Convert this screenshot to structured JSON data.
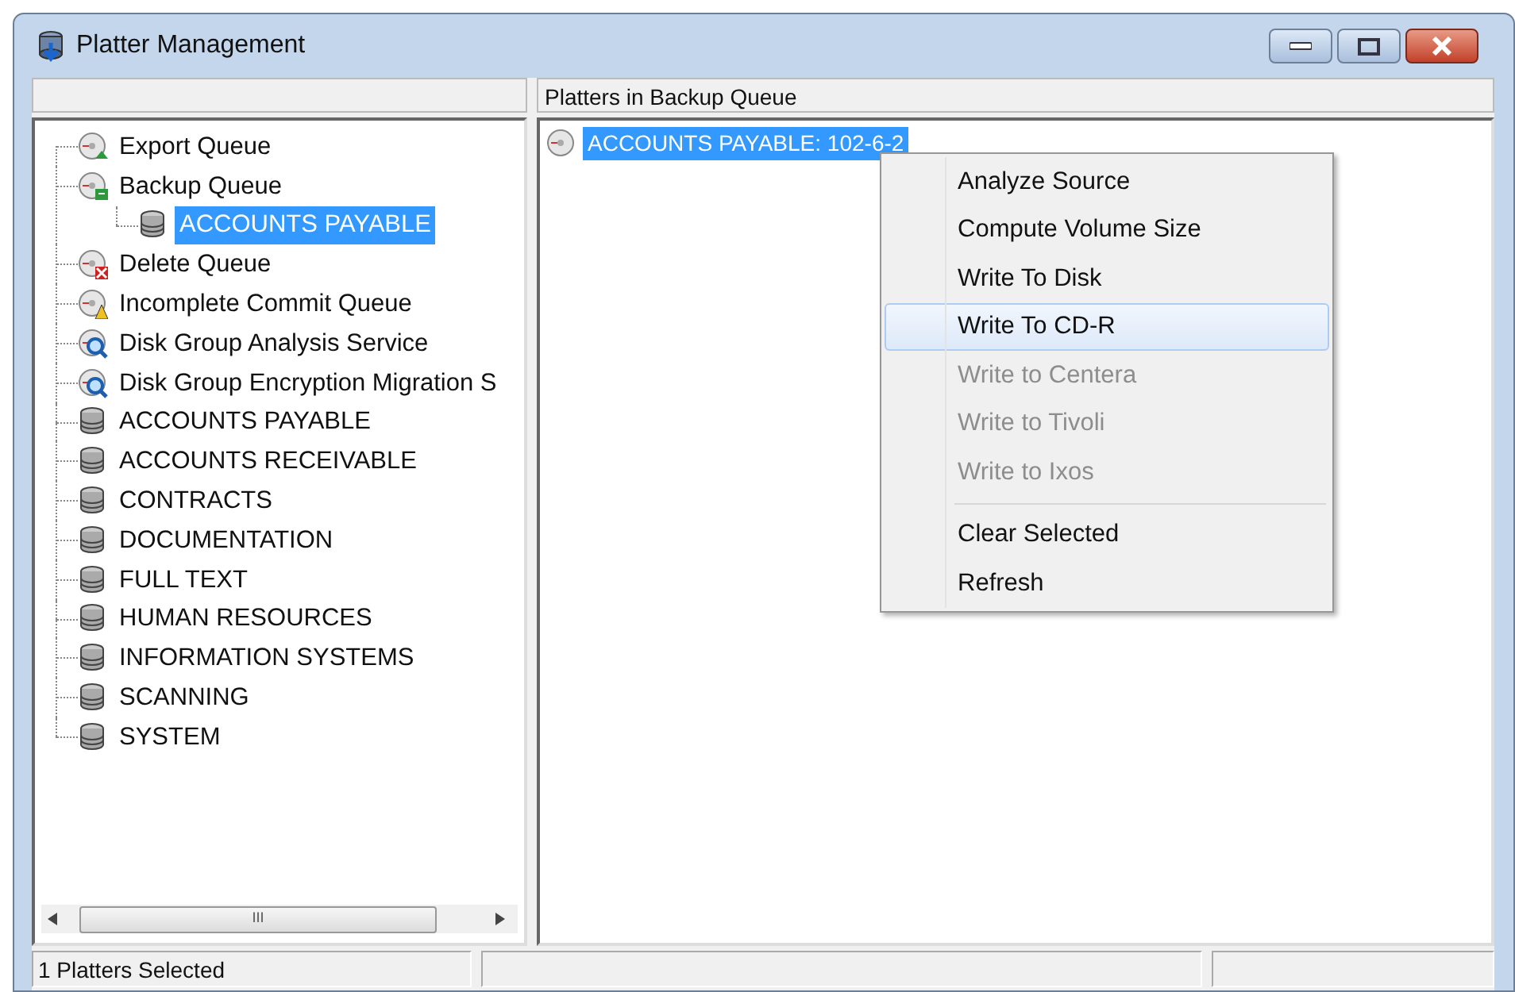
{
  "window": {
    "title": "Platter Management"
  },
  "tree": {
    "items": [
      {
        "label": "Export Queue",
        "kind": "export",
        "selected": false
      },
      {
        "label": "Backup Queue",
        "kind": "backup",
        "selected": false,
        "children": [
          {
            "label": "ACCOUNTS PAYABLE",
            "kind": "platter",
            "selected": true
          }
        ]
      },
      {
        "label": "Delete Queue",
        "kind": "delete",
        "selected": false
      },
      {
        "label": "Incomplete Commit Queue",
        "kind": "incomplete",
        "selected": false
      },
      {
        "label": "Disk Group Analysis Service",
        "kind": "analysis",
        "selected": false
      },
      {
        "label": "Disk Group Encryption Migration S",
        "kind": "analysis",
        "selected": false
      },
      {
        "label": "ACCOUNTS PAYABLE",
        "kind": "platter",
        "selected": false
      },
      {
        "label": "ACCOUNTS RECEIVABLE",
        "kind": "platter",
        "selected": false
      },
      {
        "label": "CONTRACTS",
        "kind": "platter",
        "selected": false
      },
      {
        "label": "DOCUMENTATION",
        "kind": "platter",
        "selected": false
      },
      {
        "label": "FULL TEXT",
        "kind": "platter",
        "selected": false
      },
      {
        "label": "HUMAN RESOURCES",
        "kind": "platter",
        "selected": false
      },
      {
        "label": "INFORMATION SYSTEMS",
        "kind": "platter",
        "selected": false
      },
      {
        "label": "SCANNING",
        "kind": "platter",
        "selected": false
      },
      {
        "label": "SYSTEM",
        "kind": "platter",
        "selected": false
      }
    ],
    "scrollbar_grip": "III"
  },
  "list": {
    "header": "Platters in Backup Queue",
    "items": [
      {
        "label": "ACCOUNTS PAYABLE: 102-6-2",
        "selected": true
      }
    ]
  },
  "context_menu": {
    "items": [
      {
        "kind": "item",
        "label": "Analyze Source",
        "disabled": false,
        "selected": false
      },
      {
        "kind": "item",
        "label": "Compute Volume Size",
        "disabled": false,
        "selected": false
      },
      {
        "kind": "item",
        "label": "Write To Disk",
        "disabled": false,
        "selected": false
      },
      {
        "kind": "item",
        "label": "Write To CD-R",
        "disabled": false,
        "selected": true
      },
      {
        "kind": "item",
        "label": "Write to Centera",
        "disabled": true,
        "selected": false
      },
      {
        "kind": "item",
        "label": "Write to Tivoli",
        "disabled": true,
        "selected": false
      },
      {
        "kind": "item",
        "label": "Write to Ixos",
        "disabled": true,
        "selected": false
      },
      {
        "kind": "separator"
      },
      {
        "kind": "item",
        "label": "Clear Selected",
        "disabled": false,
        "selected": false
      },
      {
        "kind": "item",
        "label": "Refresh",
        "disabled": false,
        "selected": false
      }
    ]
  },
  "status_bar": {
    "text": "1 Platters Selected"
  }
}
